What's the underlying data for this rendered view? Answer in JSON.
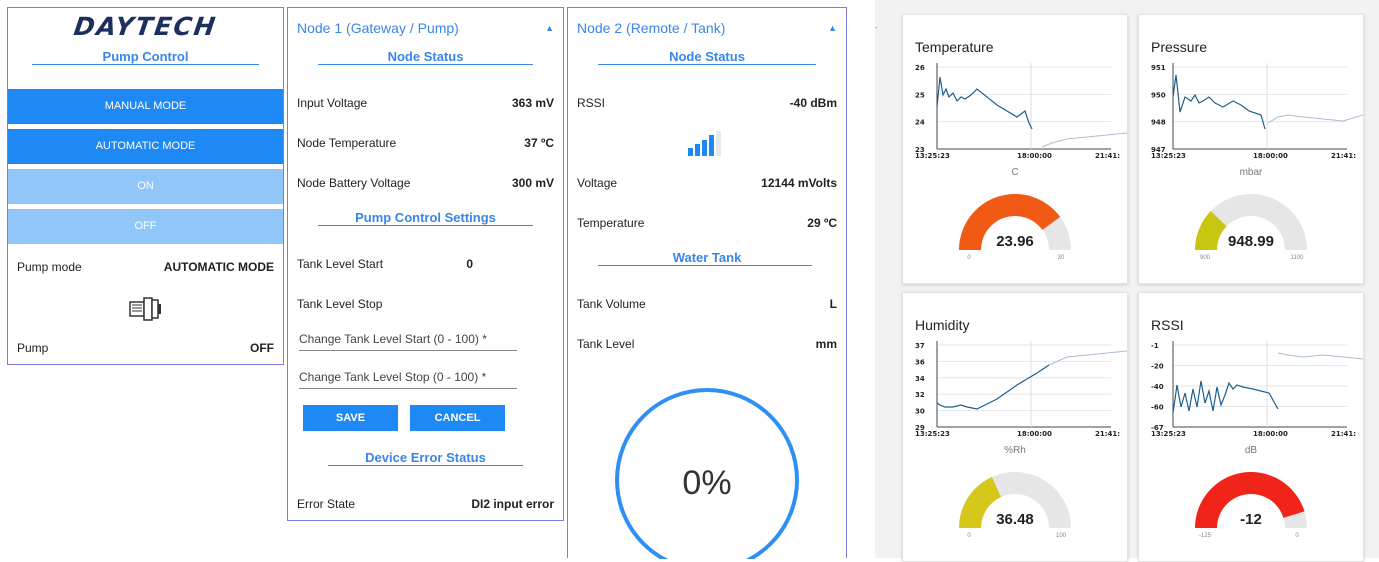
{
  "pump_panel": {
    "logo": "DAYTECH",
    "title": "Pump Control",
    "buttons": [
      {
        "label": "MANUAL MODE"
      },
      {
        "label": "AUTOMATIC MODE"
      },
      {
        "label": "ON"
      },
      {
        "label": "OFF"
      }
    ],
    "pump_mode_label": "Pump mode",
    "pump_mode_value": "AUTOMATIC MODE",
    "pump_label": "Pump",
    "pump_value": "OFF"
  },
  "node1": {
    "title": "Node 1 (Gateway / Pump)",
    "status_title": "Node Status",
    "rows": [
      {
        "label": "Input Voltage",
        "value": "363 mV"
      },
      {
        "label": "Node Temperature",
        "value": "37 ºC"
      },
      {
        "label": "Node Battery Voltage",
        "value": "300 mV"
      }
    ],
    "settings_title": "Pump Control Settings",
    "tank_start_label": "Tank Level Start",
    "tank_start_value": "0",
    "tank_stop_label": "Tank Level Stop",
    "tank_stop_value": "",
    "input_start_placeholder": "Change Tank Level Start (0 - 100) *",
    "input_stop_placeholder": "Change Tank Level Stop (0 - 100) *",
    "save_label": "SAVE",
    "cancel_label": "CANCEL",
    "error_title": "Device Error Status",
    "error_label": "Error State",
    "error_value": "DI2 input error"
  },
  "node2": {
    "title": "Node 2 (Remote / Tank)",
    "status_title": "Node Status",
    "rssi_label": "RSSI",
    "rssi_value": "-40 dBm",
    "voltage_label": "Voltage",
    "voltage_value": "12144 mVolts",
    "temp_label": "Temperature",
    "temp_value": "29 ºC",
    "tank_title": "Water Tank",
    "volume_label": "Tank Volume",
    "volume_value": "L",
    "level_label": "Tank Level",
    "level_value": "mm",
    "gauge_value": "0%",
    "signal_bars": 4
  },
  "dashboard": {
    "time_ticks": [
      "13:25:23",
      "18:00:00",
      "21:41:"
    ],
    "cards": [
      {
        "title": "Temperature",
        "unit": "C",
        "value": "23.96",
        "min": "0",
        "max": "30",
        "yticks": [
          "26",
          "25",
          "24",
          "23"
        ],
        "gauge_color": "#f05a14",
        "fraction": 0.7987
      },
      {
        "title": "Pressure",
        "unit": "mbar",
        "value": "948.99",
        "min": "900",
        "max": "1100",
        "yticks": [
          "951",
          "950",
          "948",
          "947"
        ],
        "gauge_color": "#c9c612",
        "fraction": 0.245
      },
      {
        "title": "Humidity",
        "unit": "%Rh",
        "value": "36.48",
        "min": "0",
        "max": "100",
        "yticks": [
          "37",
          "36",
          "34",
          "32",
          "30",
          "29"
        ],
        "gauge_color": "#d6c81a",
        "fraction": 0.3648
      },
      {
        "title": "RSSI",
        "unit": "dB",
        "value": "-12",
        "min": "-125",
        "max": "0",
        "yticks": [
          "-1",
          "-20",
          "-40",
          "-60",
          "-67"
        ],
        "gauge_color": "#f02418",
        "fraction": 0.904
      }
    ]
  }
}
